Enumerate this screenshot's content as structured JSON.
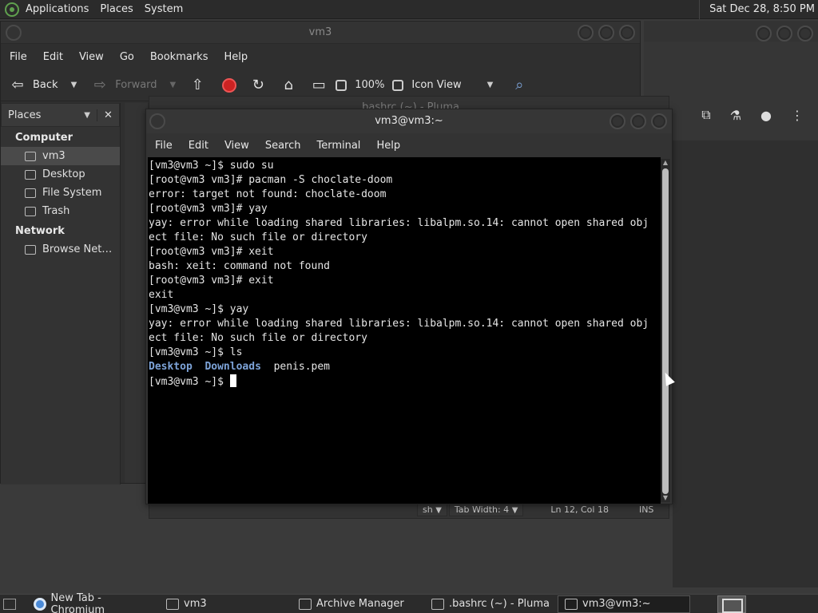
{
  "top_panel": {
    "menus": [
      "Applications",
      "Places",
      "System"
    ],
    "clock": "Sat Dec 28,  8:50 PM"
  },
  "file_manager": {
    "title": "vm3",
    "menus": [
      "File",
      "Edit",
      "View",
      "Go",
      "Bookmarks",
      "Help"
    ],
    "toolbar": {
      "back": "Back",
      "forward": "Forward",
      "zoom": "100%",
      "view_mode": "Icon View"
    },
    "sidebar": {
      "header": "Places",
      "computer_heading": "Computer",
      "computer_items": [
        "vm3",
        "Desktop",
        "File System",
        "Trash"
      ],
      "network_heading": "Network",
      "network_items": [
        "Browse Net…"
      ]
    }
  },
  "pluma": {
    "title": ".bashrc (~) - Pluma",
    "status": {
      "language": "sh",
      "tab_width": "Tab Width:  4",
      "position": "Ln 12, Col 18",
      "mode": "INS"
    }
  },
  "terminal": {
    "title": "vm3@vm3:~",
    "menus": [
      "File",
      "Edit",
      "View",
      "Search",
      "Terminal",
      "Help"
    ],
    "lines": [
      "[vm3@vm3 ~]$ sudo su",
      "[root@vm3 vm3]# pacman -S choclate-doom",
      "error: target not found: choclate-doom",
      "[root@vm3 vm3]# yay",
      "yay: error while loading shared libraries: libalpm.so.14: cannot open shared obj",
      "ect file: No such file or directory",
      "[root@vm3 vm3]# xeit",
      "bash: xeit: command not found",
      "[root@vm3 vm3]# exit",
      "exit",
      "[vm3@vm3 ~]$ yay",
      "yay: error while loading shared libraries: libalpm.so.14: cannot open shared obj",
      "ect file: No such file or directory",
      "[vm3@vm3 ~]$ ls"
    ],
    "ls_output": {
      "dir1": "Desktop",
      "dir2": "Downloads",
      "file1": "penis.pem"
    },
    "prompt": "[vm3@vm3 ~]$ "
  },
  "taskbar": {
    "tasks": [
      "New Tab - Chromium",
      "vm3",
      "Archive Manager",
      ".bashrc (~) - Pluma",
      "vm3@vm3:~"
    ]
  },
  "colors": {
    "terminal_bg": "#000000",
    "ls_dir": "#7da3d8",
    "stop_red": "#cc2222"
  }
}
